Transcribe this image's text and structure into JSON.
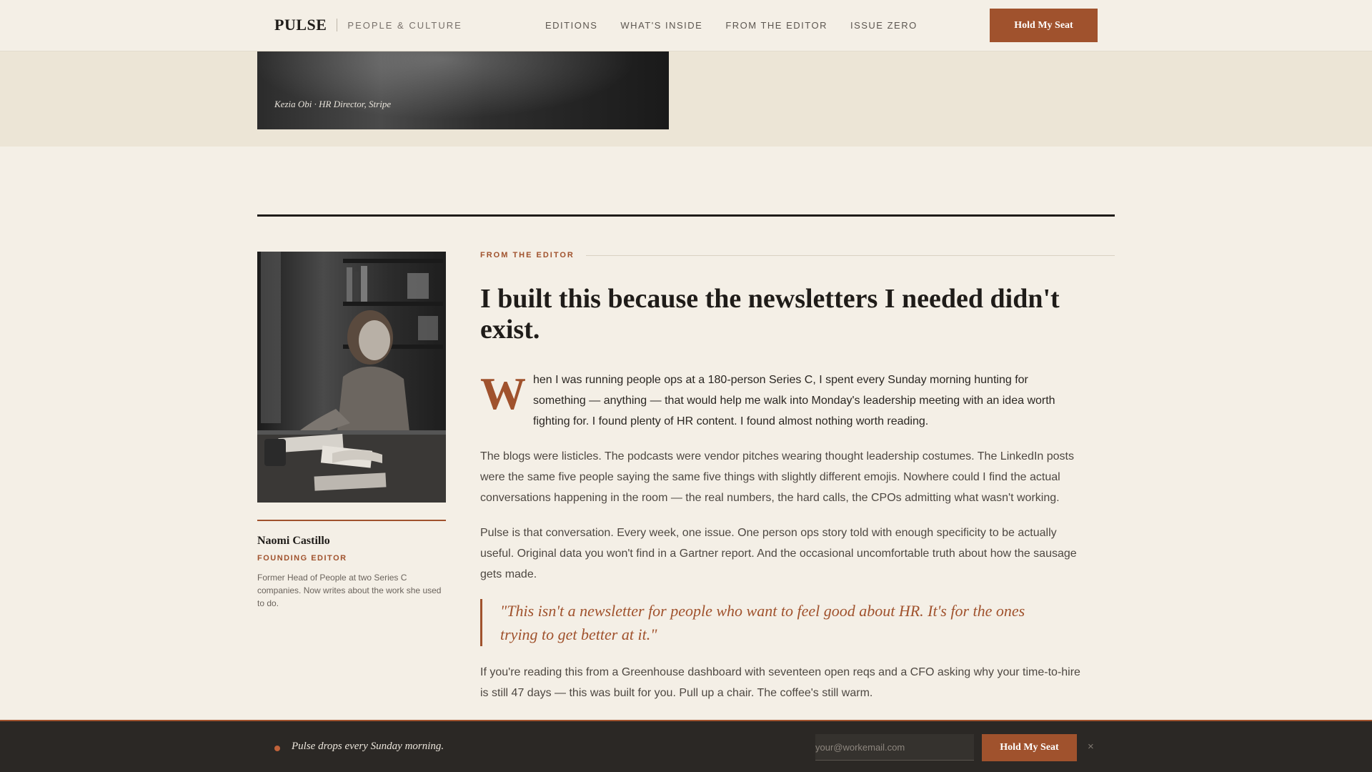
{
  "header": {
    "brand": "PULSE",
    "tagline": "PEOPLE & CULTURE",
    "nav": [
      "EDITIONS",
      "WHAT'S INSIDE",
      "FROM THE EDITOR",
      "ISSUE ZERO"
    ],
    "cta_label": "Hold My Seat"
  },
  "hero": {
    "caption": "Kezia Obi · HR Director, Stripe"
  },
  "editor": {
    "name": "Naomi Castillo",
    "role": "FOUNDING EDITOR",
    "bio": "Former Head of People at two Series C companies. Now writes about the work she used to do."
  },
  "article": {
    "kicker": "FROM THE EDITOR",
    "headline": "I built this because the newsletters I needed didn't exist.",
    "dropcap": "W",
    "p1": "hen I was running people ops at a 180-person Series C, I spent every Sunday morning hunting for something — anything — that would help me walk into Monday's leadership meeting with an idea worth fighting for. I found plenty of HR content. I found almost nothing worth reading.",
    "p2": "The blogs were listicles. The podcasts were vendor pitches wearing thought leadership costumes. The LinkedIn posts were the same five people saying the same five things with slightly different emojis. Nowhere could I find the actual conversations happening in the room — the real numbers, the hard calls, the CPOs admitting what wasn't working.",
    "p3": "Pulse is that conversation. Every week, one issue. One person ops story told with enough specificity to be actually useful. Original data you won't find in a Gartner report. And the occasional uncomfortable truth about how the sausage gets made.",
    "quote": "\"This isn't a newsletter for people who want to feel good about HR. It's for the ones trying to get better at it.\"",
    "p4": "If you're reading this from a Greenhouse dashboard with seventeen open reqs and a CFO asking why your time-to-hire is still 47 days — this was built for you. Pull up a chair. The coffee's still warm."
  },
  "footer": {
    "message": "Pulse drops every Sunday morning.",
    "email_placeholder": "your@workemail.com",
    "cta_label": "Hold My Seat",
    "close_glyph": "×"
  },
  "colors": {
    "accent": "#a0522d",
    "background": "#f4efe6",
    "band": "#ece5d6",
    "ink": "#1f1c19",
    "footer": "#2b2825"
  },
  "icons": [
    "status-dot-icon",
    "close-icon"
  ]
}
